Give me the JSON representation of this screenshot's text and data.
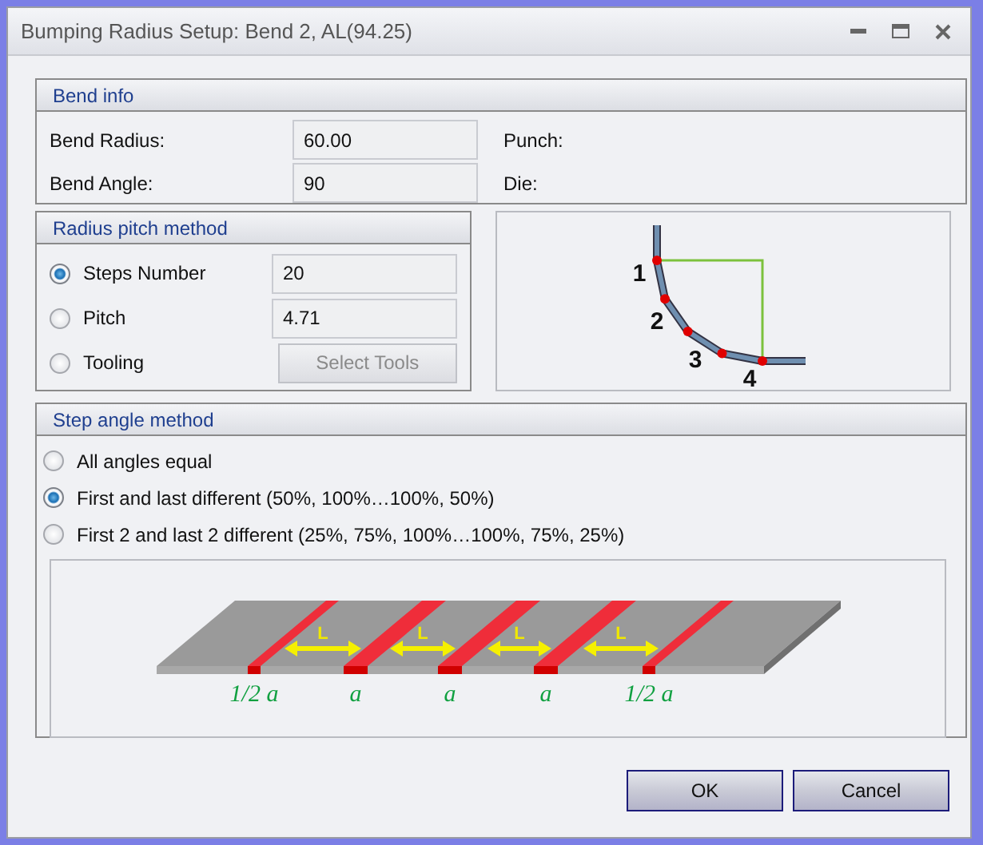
{
  "window": {
    "title": "Bumping Radius Setup: Bend 2, AL(94.25)"
  },
  "bend_info": {
    "title": "Bend info",
    "fields": [
      {
        "label": "Bend Radius:",
        "value": "60.00",
        "side_label": "Punch:"
      },
      {
        "label": "Bend Angle:",
        "value": "90",
        "side_label": "Die:"
      }
    ]
  },
  "radius_pitch": {
    "title": "Radius pitch method",
    "options": [
      {
        "label": "Steps Number",
        "selected": true,
        "kind": "field",
        "value": "20"
      },
      {
        "label": "Pitch",
        "selected": false,
        "kind": "field",
        "value": "4.71"
      },
      {
        "label": "Tooling",
        "selected": false,
        "kind": "button",
        "button": "Select Tools",
        "disabled": true
      }
    ]
  },
  "bend_diagram": {
    "step_labels": [
      "1",
      "2",
      "3",
      "4"
    ]
  },
  "step_angle": {
    "title": "Step angle method",
    "options": [
      {
        "label": "All angles equal",
        "selected": false
      },
      {
        "label": "First and last different (50%, 100%…100%, 50%)",
        "selected": true
      },
      {
        "label": "First 2 and last 2 different (25%, 75%, 100%…100%, 75%, 25%)",
        "selected": false
      }
    ],
    "diagram": {
      "spacing_labels": [
        "L",
        "L",
        "L",
        "L"
      ],
      "stripe_labels": [
        "1/2 a",
        "a",
        "a",
        "a",
        "1/2 a"
      ]
    }
  },
  "buttons": [
    {
      "label": "OK"
    },
    {
      "label": "Cancel"
    }
  ]
}
